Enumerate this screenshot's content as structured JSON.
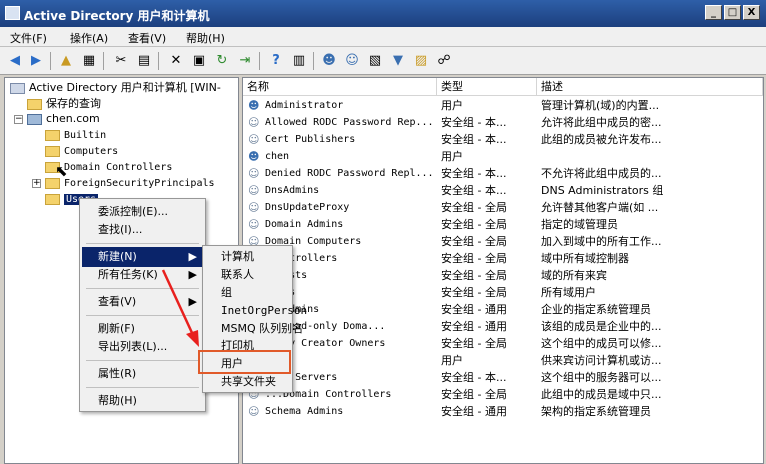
{
  "window": {
    "title": "Active Directory 用户和计算机",
    "btn_min": "_",
    "btn_max": "□",
    "btn_close": "X"
  },
  "menubar": [
    "文件(F)",
    "操作(A)",
    "查看(V)",
    "帮助(H)"
  ],
  "tree": {
    "root": "Active Directory 用户和计算机 [WIN-",
    "saved_queries": "保存的查询",
    "domain": "chen.com",
    "items": [
      "Builtin",
      "Computers",
      "Domain Controllers",
      "ForeignSecurityPrincipals",
      "Users"
    ]
  },
  "columns": {
    "name": "名称",
    "type": "类型",
    "desc": "描述"
  },
  "rows": [
    {
      "name": "Administrator",
      "type": "用户",
      "desc": "管理计算机(域)的内置..."
    },
    {
      "name": "Allowed RODC Password Rep...",
      "type": "安全组 - 本...",
      "desc": "允许将此组中成员的密..."
    },
    {
      "name": "Cert Publishers",
      "type": "安全组 - 本...",
      "desc": "此组的成员被允许发布..."
    },
    {
      "name": "chen",
      "type": "用户",
      "desc": ""
    },
    {
      "name": "Denied RODC Password Repl...",
      "type": "安全组 - 本...",
      "desc": "不允许将此组中成员的..."
    },
    {
      "name": "DnsAdmins",
      "type": "安全组 - 本...",
      "desc": "DNS Administrators 组"
    },
    {
      "name": "DnsUpdateProxy",
      "type": "安全组 - 全局",
      "desc": "允许替其他客户端(如 ..."
    },
    {
      "name": "Domain Admins",
      "type": "安全组 - 全局",
      "desc": "指定的域管理员"
    },
    {
      "name": "Domain Computers",
      "type": "安全组 - 全局",
      "desc": "加入到域中的所有工作..."
    },
    {
      "name": "...ntrollers",
      "type": "安全组 - 全局",
      "desc": "域中所有域控制器"
    },
    {
      "name": "...ests",
      "type": "安全组 - 全局",
      "desc": "域的所有来宾"
    },
    {
      "name": "...rs",
      "type": "安全组 - 全局",
      "desc": "所有域用户"
    },
    {
      "name": "...Admins",
      "type": "安全组 - 通用",
      "desc": "企业的指定系统管理员"
    },
    {
      "name": "...Read-only Doma...",
      "type": "安全组 - 通用",
      "desc": "该组的成员是企业中的..."
    },
    {
      "name": "...cy Creator Owners",
      "type": "安全组 - 全局",
      "desc": "这个组中的成员可以修..."
    },
    {
      "name": "",
      "type": "用户",
      "desc": "供来宾访问计算机或访..."
    },
    {
      "name": "...S Servers",
      "type": "安全组 - 本...",
      "desc": "这个组中的服务器可以..."
    },
    {
      "name": "...Domain Controllers",
      "type": "安全组 - 全局",
      "desc": "此组中的成员是域中只..."
    },
    {
      "name": "Schema Admins",
      "type": "安全组 - 通用",
      "desc": "架构的指定系统管理员"
    }
  ],
  "context_menu": [
    "委派控制(E)...",
    "查找(I)...",
    "新建(N)",
    "所有任务(K)",
    "查看(V)",
    "刷新(F)",
    "导出列表(L)...",
    "属性(R)",
    "帮助(H)"
  ],
  "submenu": [
    "计算机",
    "联系人",
    "组",
    "InetOrgPerson",
    "MSMQ 队列别名",
    "打印机",
    "用户",
    "共享文件夹"
  ],
  "colors": {
    "highlight": "#0a246a",
    "annotation": "#e15a2a",
    "arrow": "#e8201e"
  }
}
